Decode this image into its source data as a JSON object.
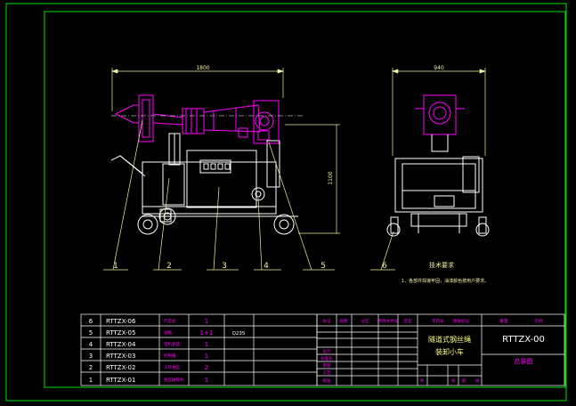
{
  "colors": {
    "background": "#000000",
    "frame": "#00e000",
    "geometry": "#ffffff",
    "parts": "#ff00ff",
    "dimension": "#f0f0a0",
    "table_text": "#ffffff",
    "table_labels": "#ff00ff",
    "title_text": "#ffff80"
  },
  "dimensions": {
    "side_length": "1800",
    "side_height": "1100",
    "front_width": "940"
  },
  "balloons": [
    "1",
    "2",
    "3",
    "4",
    "5",
    "6"
  ],
  "notes": {
    "title": "技术要求",
    "body": "1、各部件焊接牢固，油漆颜色按用户要求。"
  },
  "parts_list": [
    {
      "no": "6",
      "code": "RTTZX-06",
      "name": "行走轮",
      "qty": "1",
      "material": ""
    },
    {
      "no": "5",
      "code": "RTTZX-05",
      "name": "油箱",
      "qty": "1+1",
      "material": "Q235"
    },
    {
      "no": "4",
      "code": "RTTZX-04",
      "name": "电机总成",
      "qty": "1",
      "material": ""
    },
    {
      "no": "3",
      "code": "RTTZX-03",
      "name": "控制箱",
      "qty": "1",
      "material": ""
    },
    {
      "no": "2",
      "code": "RTTZX-02",
      "name": "工作油缸",
      "qty": "2",
      "material": ""
    },
    {
      "no": "1",
      "code": "RTTZX-01",
      "name": "液压破碎机",
      "qty": "1",
      "material": ""
    }
  ],
  "title_block": {
    "headers": [
      "标记",
      "处数",
      "分区",
      "更改文件号",
      "签名",
      "年月日"
    ],
    "header_right": [
      "图样标记",
      "重量",
      "比例"
    ],
    "drawing_code": "RTTZX-00",
    "product_name": "隧道式钢丝绳",
    "product_name_2": "装卸小车",
    "drawing_type": "总装图",
    "sign_rows": [
      "设计",
      "标准化",
      "审核",
      "工艺",
      "批准"
    ],
    "sheet_labels": [
      "共",
      "张",
      "第",
      "张"
    ]
  }
}
